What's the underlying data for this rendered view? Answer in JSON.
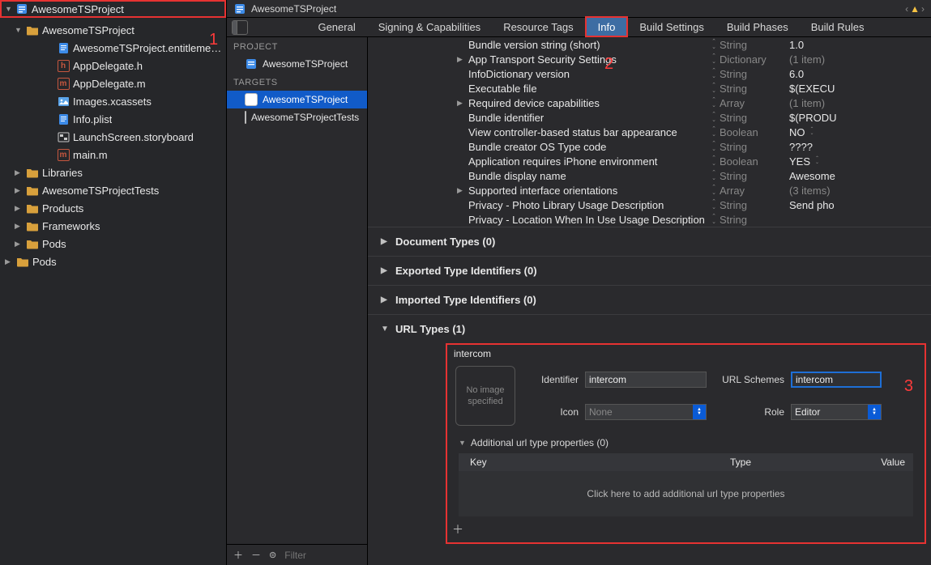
{
  "navigator": {
    "root": "AwesomeTSProject",
    "items": [
      {
        "icon": "folder-yellow",
        "label": "AwesomeTSProject",
        "depth": 0,
        "open": true
      },
      {
        "icon": "file-blue",
        "label": "AwesomeTSProject.entitleme…",
        "depth": 2,
        "leaf": true
      },
      {
        "icon": "file-h",
        "label": "AppDelegate.h",
        "depth": 2,
        "leaf": true
      },
      {
        "icon": "file-m",
        "label": "AppDelegate.m",
        "depth": 2,
        "leaf": true
      },
      {
        "icon": "asset",
        "label": "Images.xcassets",
        "depth": 2,
        "leaf": true
      },
      {
        "icon": "file-blue",
        "label": "Info.plist",
        "depth": 2,
        "leaf": true
      },
      {
        "icon": "storyboard",
        "label": "LaunchScreen.storyboard",
        "depth": 2,
        "leaf": true
      },
      {
        "icon": "file-m",
        "label": "main.m",
        "depth": 2,
        "leaf": true
      },
      {
        "icon": "folder-yellow",
        "label": "Libraries",
        "depth": 0,
        "open": false
      },
      {
        "icon": "folder-yellow",
        "label": "AwesomeTSProjectTests",
        "depth": 0,
        "open": false
      },
      {
        "icon": "folder-yellow",
        "label": "Products",
        "depth": 0,
        "open": false
      },
      {
        "icon": "folder-yellow",
        "label": "Frameworks",
        "depth": 0,
        "open": false
      },
      {
        "icon": "folder-yellow",
        "label": "Pods",
        "depth": 0,
        "open": false
      },
      {
        "icon": "folder-yellow",
        "label": "Pods",
        "depth": -1,
        "open": false
      }
    ]
  },
  "annotations": {
    "a1": "1",
    "a2": "2",
    "a3": "3"
  },
  "breadcrumb": {
    "project": "AwesomeTSProject"
  },
  "tabs": {
    "items": [
      "General",
      "Signing & Capabilities",
      "Resource Tags",
      "Info",
      "Build Settings",
      "Build Phases",
      "Build Rules"
    ],
    "active": 3
  },
  "targets": {
    "project_header": "PROJECT",
    "project_item": "AwesomeTSProject",
    "targets_header": "TARGETS",
    "target_items": [
      "AwesomeTSProject",
      "AwesomeTSProjectTests"
    ],
    "filter_placeholder": "Filter"
  },
  "plist": [
    {
      "key": "Bundle version string (short)",
      "type": "String",
      "value": "1.0"
    },
    {
      "key": "App Transport Security Settings",
      "type": "Dictionary",
      "value": "(1 item)",
      "expandable": true,
      "dim": true
    },
    {
      "key": "InfoDictionary version",
      "type": "String",
      "value": "6.0"
    },
    {
      "key": "Executable file",
      "type": "String",
      "value": "$(EXECU"
    },
    {
      "key": "Required device capabilities",
      "type": "Array",
      "value": "(1 item)",
      "expandable": true,
      "dim": true
    },
    {
      "key": "Bundle identifier",
      "type": "String",
      "value": "$(PRODU"
    },
    {
      "key": "View controller-based status bar appearance",
      "type": "Boolean",
      "value": "NO",
      "stepper": true
    },
    {
      "key": "Bundle creator OS Type code",
      "type": "String",
      "value": "????"
    },
    {
      "key": "Application requires iPhone environment",
      "type": "Boolean",
      "value": "YES",
      "stepper": true
    },
    {
      "key": "Bundle display name",
      "type": "String",
      "value": "Awesome"
    },
    {
      "key": "Supported interface orientations",
      "type": "Array",
      "value": "(3 items)",
      "expandable": true,
      "dim": true
    },
    {
      "key": "Privacy - Photo Library Usage Description",
      "type": "String",
      "value": "Send pho"
    },
    {
      "key": "Privacy - Location When In Use Usage Description",
      "type": "String",
      "value": ""
    }
  ],
  "sections": {
    "doc_types": "Document Types (0)",
    "exported": "Exported Type Identifiers (0)",
    "imported": "Imported Type Identifiers (0)",
    "url_types": "URL Types (1)"
  },
  "url_type": {
    "name": "intercom",
    "img_well": "No\nimage\nspecified",
    "identifier_label": "Identifier",
    "identifier_value": "intercom",
    "schemes_label": "URL Schemes",
    "schemes_value": "intercom",
    "icon_label": "Icon",
    "icon_value": "None",
    "role_label": "Role",
    "role_value": "Editor",
    "additional_header": "Additional url type properties (0)",
    "col_key": "Key",
    "col_type": "Type",
    "col_value": "Value",
    "empty_text": "Click here to add additional url type properties"
  }
}
